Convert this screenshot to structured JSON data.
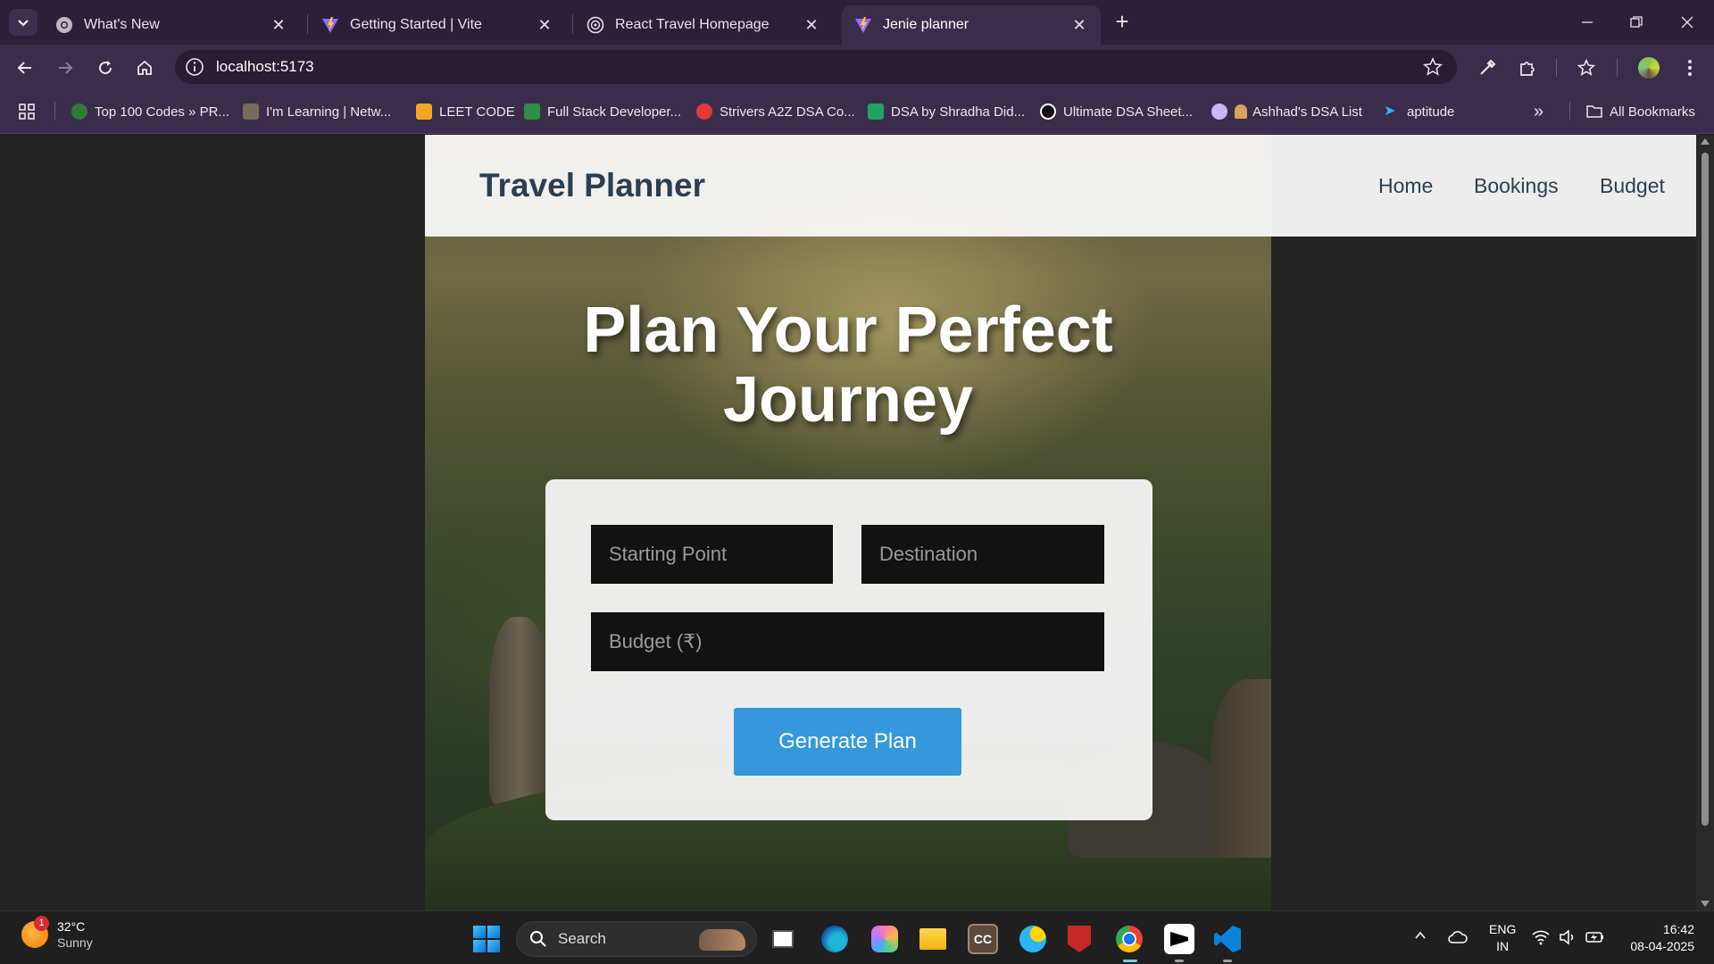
{
  "browser": {
    "tabs": [
      {
        "title": "What's New",
        "icon": "chrome-icon"
      },
      {
        "title": "Getting Started | Vite",
        "icon": "vite-icon"
      },
      {
        "title": "React Travel Homepage",
        "icon": "globe-icon"
      },
      {
        "title": "Jenie planner",
        "icon": "vite-icon",
        "active": true
      }
    ],
    "url": "localhost:5173",
    "bookmarks": [
      {
        "label": "Top 100 Codes » PR...",
        "color": "#2e7d32"
      },
      {
        "label": "I'm Learning | Netw...",
        "color": "#7a6a5a"
      },
      {
        "label": "LEET CODE",
        "color": "#f5a623"
      },
      {
        "label": "Full Stack Developer...",
        "color": "#2f8d46"
      },
      {
        "label": "Strivers A2Z DSA Co...",
        "color": "#e53935"
      },
      {
        "label": "DSA by Shradha Did...",
        "color": "#1fa463"
      },
      {
        "label": "Ultimate DSA Sheet...",
        "color": "#111111"
      },
      {
        "label": "Ashhad's DSA List",
        "color": "#c7b8f5"
      },
      {
        "label": "aptitude",
        "color": "#29b6f6"
      }
    ],
    "all_bookmarks_label": "All Bookmarks"
  },
  "site": {
    "brand": "Travel Planner",
    "nav": [
      "Home",
      "Bookings",
      "Budget"
    ],
    "hero_line1": "Plan Your Perfect",
    "hero_line2": "Journey",
    "form": {
      "start_placeholder": "Starting Point",
      "destination_placeholder": "Destination",
      "budget_placeholder": "Budget (₹)",
      "submit_label": "Generate Plan"
    },
    "colors": {
      "brand_text": "#2c3e50",
      "button": "#3498db",
      "input_bg": "#121212"
    }
  },
  "taskbar": {
    "weather_temp": "32°C",
    "weather_cond": "Sunny",
    "weather_badge": "1",
    "search_label": "Search",
    "lang_line1": "ENG",
    "lang_line2": "IN",
    "time": "16:42",
    "date": "08-04-2025"
  }
}
